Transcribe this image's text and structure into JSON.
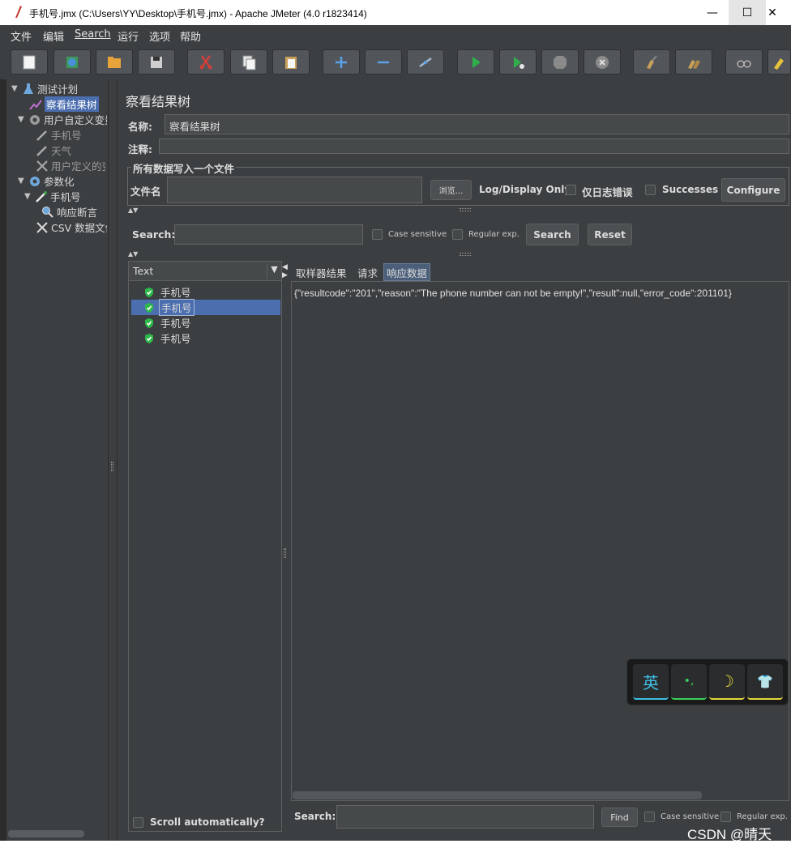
{
  "window": {
    "title": "手机号.jmx (C:\\Users\\YY\\Desktop\\手机号.jmx) - Apache JMeter (4.0 r1823414)",
    "minimize": "—",
    "maximize": "☐",
    "close": "✕"
  },
  "menu": [
    "文件",
    "编辑",
    "Search",
    "运行",
    "选项",
    "帮助"
  ],
  "toolbar_icons": [
    "new-icon",
    "templates-icon",
    "open-icon",
    "save-icon",
    "cut-icon",
    "copy-icon",
    "paste-icon",
    "expand-icon",
    "collapse-icon",
    "toggle-icon",
    "start-icon",
    "start-no-pause-icon",
    "stop-icon",
    "shutdown-icon",
    "clear-icon",
    "clear-all-icon",
    "search-icon",
    "reset-search-icon"
  ],
  "tree": {
    "items": [
      {
        "label": "测试计划",
        "icon": "flask-icon",
        "arrow": "▼"
      },
      {
        "label": "察看结果树",
        "icon": "graph-icon",
        "arrow": ""
      },
      {
        "label": "用户自定义变量",
        "icon": "gear-icon",
        "arrow": "▼"
      },
      {
        "label": "手机号",
        "icon": "pipette-icon",
        "arrow": ""
      },
      {
        "label": "天气",
        "icon": "pipette-icon",
        "arrow": ""
      },
      {
        "label": "用户定义的变量",
        "icon": "wrench-icon",
        "arrow": ""
      },
      {
        "label": "参数化",
        "icon": "gear-icon",
        "arrow": "▼"
      },
      {
        "label": "手机号",
        "icon": "pipette-icon",
        "arrow": "▼"
      },
      {
        "label": "响应断言",
        "icon": "magnifier-icon",
        "arrow": ""
      },
      {
        "label": "CSV 数据文件设置",
        "icon": "wrench-icon",
        "arrow": ""
      }
    ]
  },
  "panel": {
    "title": "察看结果树",
    "name_label": "名称:",
    "name_value": "察看结果树",
    "comment_label": "注释:",
    "comment_value": "",
    "file_section_title": "所有数据写入一个文件",
    "filename_label": "文件名",
    "filename_value": "",
    "browse_button": "浏览...",
    "log_display_label": "Log/Display Only:",
    "errors_only_label": "仅日志错误",
    "successes_label": "Successes",
    "configure_button": "Configure"
  },
  "search_bar": {
    "label": "Search:",
    "value": "",
    "case_sensitive": "Case sensitive",
    "regular_exp": "Regular exp.",
    "search_button": "Search",
    "reset_button": "Reset"
  },
  "renderer": {
    "selected": "Text",
    "arrow": "▼"
  },
  "results": [
    {
      "label": "手机号",
      "status": "success"
    },
    {
      "label": "手机号",
      "status": "success"
    },
    {
      "label": "手机号",
      "status": "success"
    },
    {
      "label": "手机号",
      "status": "success"
    }
  ],
  "tabs": [
    "取样器结果",
    "请求",
    "响应数据"
  ],
  "response_text": "{\"resultcode\":\"201\",\"reason\":\"The phone number can not be empty!\",\"result\":null,\"error_code\":201101}",
  "bottom_search": {
    "label": "Search:",
    "value": "",
    "find_button": "Find",
    "case_sensitive": "Case sensitive",
    "regular_exp": "Regular exp."
  },
  "scroll_auto_label": "Scroll automatically?",
  "ime": {
    "lang": "英",
    "punct": "•,",
    "moon": "☽",
    "shirt": "👕"
  },
  "watermark": "CSDN @晴天"
}
